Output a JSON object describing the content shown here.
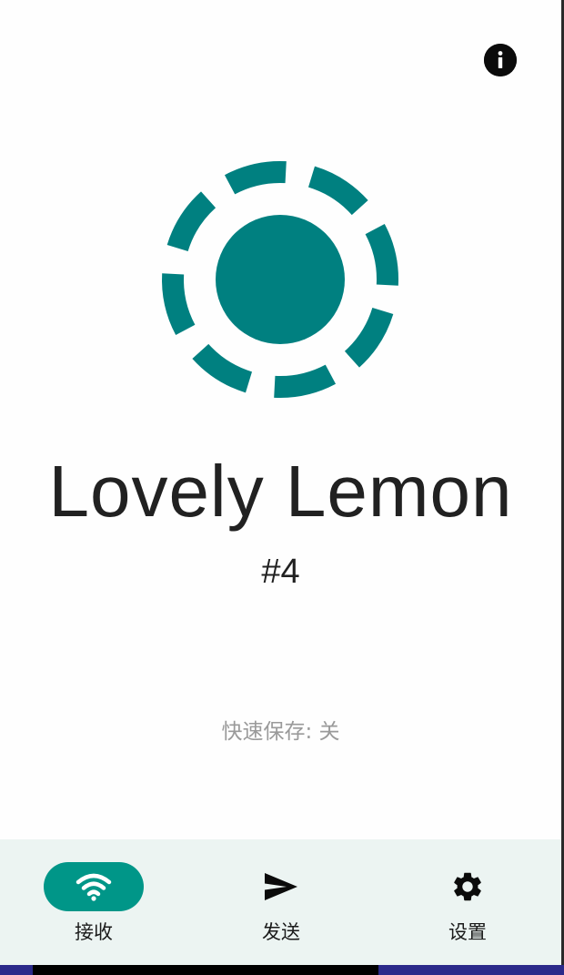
{
  "device": {
    "name": "Lovely Lemon",
    "number": "#4"
  },
  "status": {
    "quick_save": "快速保存: 关"
  },
  "nav": {
    "items": [
      {
        "label": "接收",
        "icon": "wifi-icon",
        "active": true
      },
      {
        "label": "发送",
        "icon": "send-icon",
        "active": false
      },
      {
        "label": "设置",
        "icon": "gear-icon",
        "active": false
      }
    ]
  },
  "colors": {
    "accent": "#008080",
    "active_pill": "#009688",
    "nav_background": "#ecf4f2",
    "text_primary": "#212121",
    "text_secondary": "#9a9a9a"
  }
}
